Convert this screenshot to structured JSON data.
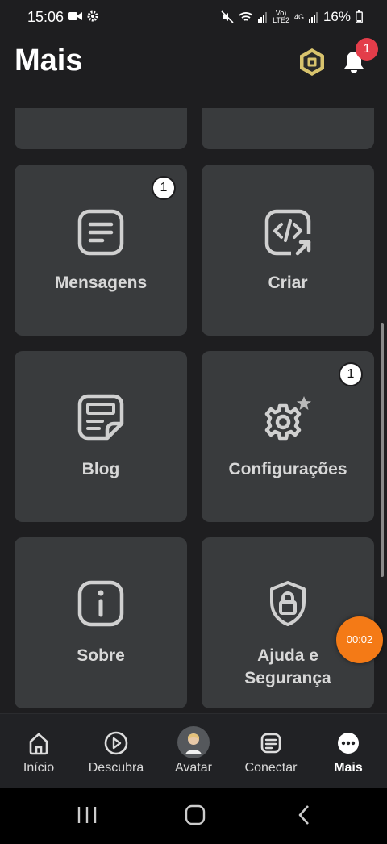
{
  "status_bar": {
    "time": "15:06",
    "network_small_1": "Vo)",
    "network_small_2": "LTE2",
    "network_small_3": "4G",
    "battery": "16%"
  },
  "header": {
    "title": "Mais",
    "notifications_count": "1"
  },
  "tiles": [
    {
      "label": "Mensagens",
      "icon": "message-icon",
      "badge": "1"
    },
    {
      "label": "Criar",
      "icon": "create-code-icon",
      "badge": ""
    },
    {
      "label": "Blog",
      "icon": "blog-icon",
      "badge": ""
    },
    {
      "label": "Configurações",
      "icon": "settings-gear-icon",
      "badge": "1"
    },
    {
      "label": "Sobre",
      "icon": "info-icon",
      "badge": ""
    },
    {
      "label": "Ajuda e Segurança",
      "icon": "shield-lock-icon",
      "badge": ""
    }
  ],
  "recording": {
    "timer": "00:02"
  },
  "bottom_nav": [
    {
      "label": "Início",
      "icon": "home-icon"
    },
    {
      "label": "Descubra",
      "icon": "play-circle-icon"
    },
    {
      "label": "Avatar",
      "icon": "avatar-icon"
    },
    {
      "label": "Conectar",
      "icon": "chat-icon"
    },
    {
      "label": "Mais",
      "icon": "more-icon",
      "active": true
    }
  ],
  "colors": {
    "background": "#1e1e20",
    "tile": "#393b3d",
    "badge_red": "#e33d4a",
    "record_orange": "#f47a16"
  }
}
